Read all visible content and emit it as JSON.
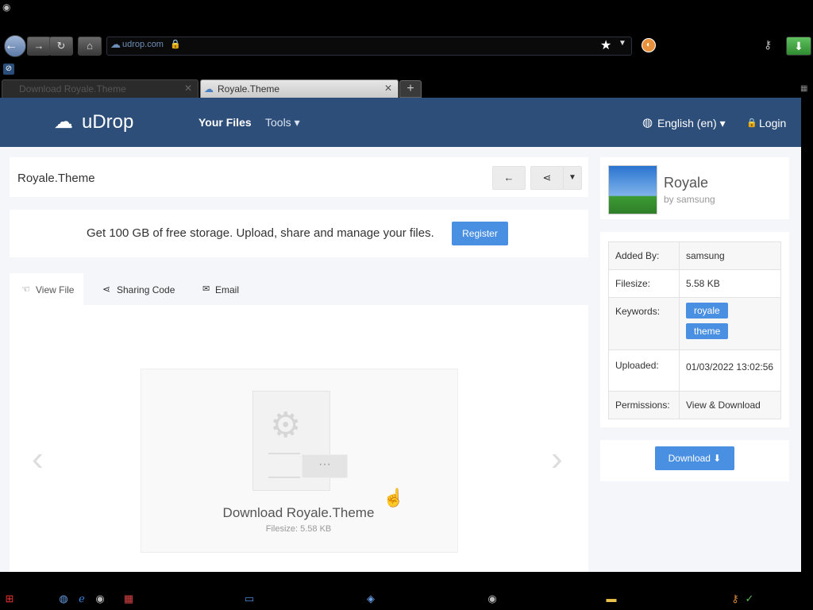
{
  "browser": {
    "url_site": "udrop.com",
    "tabs": [
      {
        "label": "Download Royale.Theme"
      },
      {
        "label": "Royale.Theme"
      }
    ],
    "new_tab_label": "+"
  },
  "site": {
    "logo": "uDrop",
    "nav": {
      "your_files": "Your Files",
      "tools": "Tools ▾",
      "language": "English (en) ▾",
      "login": "Login"
    }
  },
  "file": {
    "title": "Royale.Theme",
    "name": "Royale",
    "by": "by samsung"
  },
  "promo": {
    "text": "Get 100 GB of free storage. Upload, share and manage your files.",
    "register_label": "Register"
  },
  "viewer_tabs": [
    {
      "label": "View File",
      "icon": "hand-icon"
    },
    {
      "label": "Sharing Code",
      "icon": "share-icon"
    },
    {
      "label": "Email",
      "icon": "envelope-icon"
    }
  ],
  "preview": {
    "caption": "Download Royale.Theme",
    "filesize": "Filesize: 5.58 KB",
    "dots": "···"
  },
  "details": {
    "added_by_label": "Added By:",
    "added_by": "samsung",
    "filesize_label": "Filesize:",
    "filesize": "5.58 KB",
    "keywords_label": "Keywords:",
    "keywords": [
      "royale",
      "theme"
    ],
    "uploaded_label": "Uploaded:",
    "uploaded": "01/03/2022 13:02:56",
    "permissions_label": "Permissions:",
    "permissions": "View & Download"
  },
  "download_label": "Download ⬇",
  "colors": {
    "header": "#2e4e7a",
    "accent": "#4a90e2",
    "page_bg": "#f4f6f9"
  }
}
